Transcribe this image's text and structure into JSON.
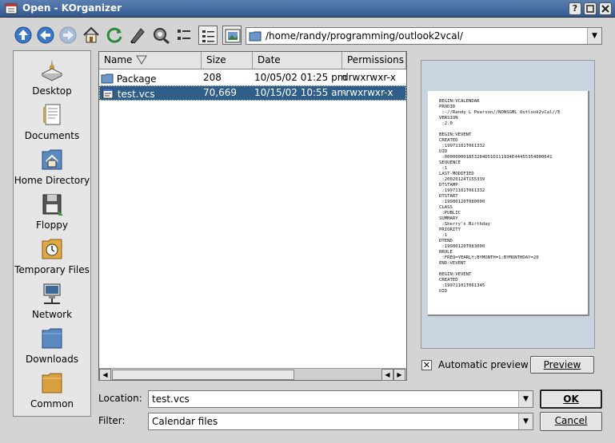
{
  "window": {
    "title": "Open - KOrganizer",
    "help_btn": "?"
  },
  "toolbar": {
    "path": "/home/randy/programming/outlook2vcal/"
  },
  "sidebar": {
    "items": [
      {
        "label": "Desktop"
      },
      {
        "label": "Documents"
      },
      {
        "label": "Home Directory"
      },
      {
        "label": "Floppy"
      },
      {
        "label": "Temporary Files"
      },
      {
        "label": "Network"
      },
      {
        "label": "Downloads"
      },
      {
        "label": "Common"
      }
    ]
  },
  "filelist": {
    "columns": [
      "Name",
      "Size",
      "Date",
      "Permissions"
    ],
    "rows": [
      {
        "name": "Package",
        "size": "208",
        "date": "10/05/02 01:25 pm",
        "perms": "drwxrwxr-x"
      },
      {
        "name": "test.vcs",
        "size": "70,669",
        "date": "10/15/02 10:55 am",
        "perms": "-rwxrwxr-x"
      }
    ]
  },
  "preview": {
    "content": "BEGIN:VCALENDAR\nPRODID\n :-//Randy L Pearson//NONSGML Outlook2vCal//E\nVERSION\n :2.0\n\nBEGIN:VEVENT\nCREATED\n :19971101T061332\nUID\n :000000001853284D51D111934E44455354000641\nSEQUENCE\n :1\nLAST-MODIFIED\n :20020124T155339\nDTSTAMP\n :19971101T061332\nDTSTART\n :19980120T080000\nCLASS\n :PUBLIC\nSUMMARY\n :Sherry's Birthday\nPRIORITY\n :1\nDTEND\n :19980120T083000\nRRULE\n :FREQ=YEARLY;BYMONTH=1;BYMONTHDAY=20\nEND:VEVENT\n\nBEGIN:VEVENT\nCREATED\n :19971101T061345\nUID",
    "auto_preview_label": "Automatic preview",
    "auto_preview_checked": "✕",
    "preview_button": "Preview"
  },
  "location": {
    "label": "Location:",
    "value": "test.vcs"
  },
  "filter": {
    "label": "Filter:",
    "value": "Calendar files"
  },
  "buttons": {
    "ok": "OK",
    "cancel": "Cancel"
  }
}
